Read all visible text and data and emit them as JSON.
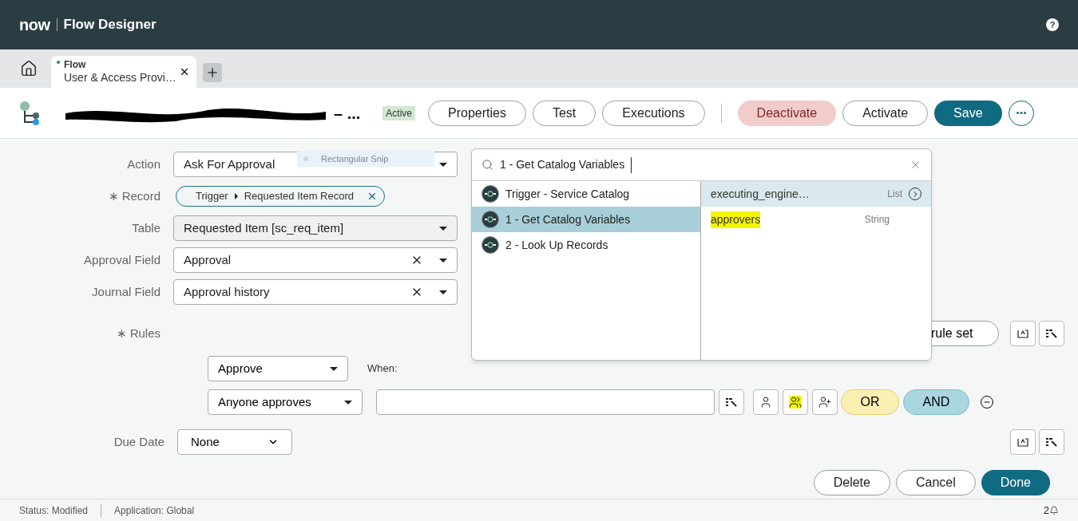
{
  "app_header": {
    "logo": "now",
    "title": "Flow Designer",
    "help": "?"
  },
  "tabs": [
    {
      "type_label": "Flow",
      "title": "User & Access Provi…",
      "selected": true,
      "modified": true
    }
  ],
  "flow_header": {
    "title_tail": "– ...",
    "status": "Active",
    "buttons": [
      {
        "label": "Properties",
        "kind": "outline"
      },
      {
        "label": "Test",
        "kind": "outline"
      },
      {
        "label": "Executions",
        "kind": "outline"
      },
      {
        "label": "Deactivate",
        "kind": "danger"
      },
      {
        "label": "Activate",
        "kind": "outline"
      },
      {
        "label": "Save",
        "kind": "primary"
      }
    ]
  },
  "form": {
    "fields": [
      {
        "label": "Action",
        "kind": "select",
        "value": "Ask For Approval"
      },
      {
        "required_mark": "∗",
        "label": "Record",
        "kind": "pill",
        "value": "Requested Item Record",
        "source": "Trigger"
      },
      {
        "label": "Table",
        "kind": "readonly_select",
        "value": "Requested Item [sc_req_item]"
      },
      {
        "label": "Approval Field",
        "kind": "clearable_select",
        "value": "Approval"
      },
      {
        "label": "Journal Field",
        "kind": "clearable_select",
        "value": "Approval history"
      }
    ],
    "rules": {
      "required_mark": "∗",
      "label": "Rules",
      "rule_set_button": "rule set",
      "action": "Approve",
      "when_label": "When:",
      "condition": "Anyone approves",
      "or_button": "OR",
      "and_button": "AND"
    },
    "due_date": {
      "label": "Due Date",
      "value": "None"
    },
    "buttons": [
      {
        "label": "Delete",
        "kind": "outline"
      },
      {
        "label": "Cancel",
        "kind": "outline"
      },
      {
        "label": "Done",
        "kind": "primary"
      }
    ]
  },
  "snip_overlay": {
    "text": "Rectangular Snip"
  },
  "data_picker": {
    "search_value": "1 - Get Catalog Variables",
    "steps": [
      {
        "label": "Trigger - Service Catalog",
        "selected": false
      },
      {
        "label": "1 - Get Catalog Variables",
        "selected": true
      },
      {
        "label": "2 - Look Up Records",
        "selected": false
      }
    ],
    "pills": [
      {
        "name": "executing_engine…",
        "type": "List",
        "expandable": true,
        "selected": true,
        "highlighted": false
      },
      {
        "name": "approvers",
        "type": "String",
        "expandable": false,
        "selected": false,
        "highlighted": true
      }
    ]
  },
  "status_bar": {
    "status": "Status: Modified",
    "application": "Application: Global",
    "notifications": "2"
  }
}
